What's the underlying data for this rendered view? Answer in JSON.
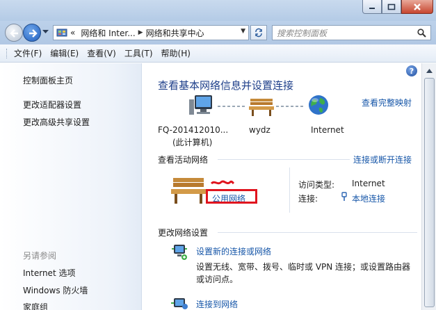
{
  "address": {
    "crumbs": [
      "«",
      "网络和 Inter...",
      "网络和共享中心"
    ]
  },
  "search": {
    "placeholder": "搜索控制面板"
  },
  "menu": [
    "文件(F)",
    "编辑(E)",
    "查看(V)",
    "工具(T)",
    "帮助(H)"
  ],
  "sidebar": {
    "links": [
      "控制面板主页",
      "更改适配器设置",
      "更改高级共享设置"
    ],
    "see_also_title": "另请参阅",
    "see_also": [
      "Internet 选项",
      "Windows 防火墙",
      "家庭组"
    ]
  },
  "main": {
    "title": "查看基本网络信息并设置连接",
    "full_map_link": "查看完整映射",
    "network_map": {
      "computer_label": "FQ-201412010...",
      "computer_sub": "(此计算机)",
      "network_label": "wydz",
      "internet_label": "Internet"
    },
    "active_heading": "查看活动网络",
    "connect_disconnect_link": "连接或断开连接",
    "active_network": {
      "type_link": "公用网络",
      "access_type_label": "访问类型:",
      "access_type_value": "Internet",
      "connection_label": "连接:",
      "connection_value": "本地连接"
    },
    "change_heading": "更改网络设置",
    "tasks": [
      {
        "title": "设置新的连接或网络",
        "desc_line1": "设置无线、宽带、拨号、临时或 VPN 连接；或设置路由器",
        "desc_line2": "或访问点。"
      },
      {
        "title": "连接到网络"
      }
    ]
  },
  "colors": {
    "link": "#1656a8",
    "title": "#1e3f8a",
    "highlight_box": "#e0141e"
  }
}
